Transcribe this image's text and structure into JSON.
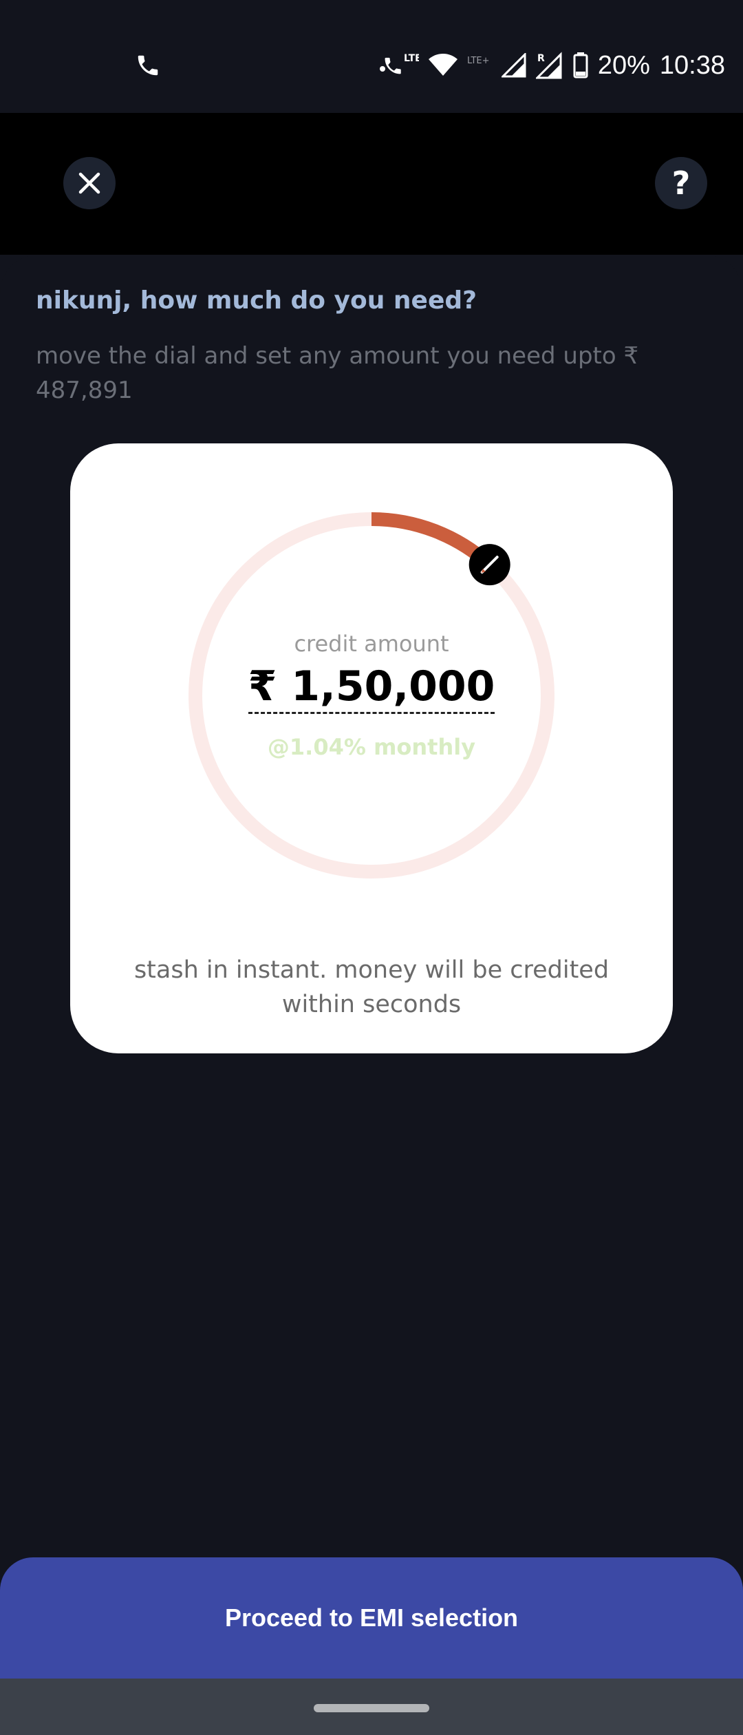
{
  "status_bar": {
    "battery_percent": "20%",
    "time": "10:38",
    "lte_label": "LTE",
    "lte_plus_label": "LTE+",
    "roaming_label": "R"
  },
  "header": {
    "close_icon": "close-icon",
    "help_label": "?"
  },
  "content": {
    "heading": "nikunj, how much do you need?",
    "subtext": "move the dial and set any amount you need upto ₹ 487,891"
  },
  "card": {
    "credit_label": "credit amount",
    "amount": "₹ 1,50,000",
    "rate": "@1.04% monthly",
    "note": "stash in instant. money will be credited within seconds",
    "dial_fraction": 0.117
  },
  "cta": {
    "label": "Proceed to EMI selection"
  },
  "colors": {
    "accent": "#cb5e3d",
    "track": "#fbeae8",
    "button": "#3c49a5",
    "heading": "#a3b9d9",
    "rate": "#d8ecc2"
  }
}
